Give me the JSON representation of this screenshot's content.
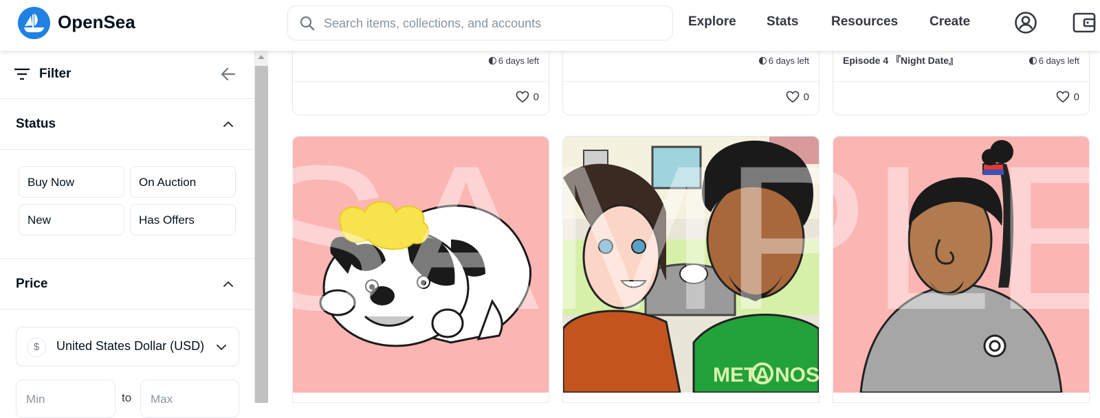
{
  "header": {
    "brand": "OpenSea",
    "search_placeholder": "Search items, collections, and accounts",
    "nav": {
      "explore": "Explore",
      "stats": "Stats",
      "resources": "Resources",
      "create": "Create"
    }
  },
  "sidebar": {
    "filter_label": "Filter",
    "status": {
      "title": "Status",
      "options": [
        "Buy Now",
        "On Auction",
        "New",
        "Has Offers"
      ]
    },
    "price": {
      "title": "Price",
      "currency": "United States Dollar (USD)",
      "currency_symbol": "$",
      "min_placeholder": "Min",
      "to_label": "to",
      "max_placeholder": "Max"
    }
  },
  "cards_top": [
    {
      "title": "",
      "time_left": "6 days left",
      "favorites": "0"
    },
    {
      "title": "",
      "time_left": "6 days left",
      "favorites": "0"
    },
    {
      "title": "Episode 4 『Night Date』",
      "time_left": "6 days left",
      "favorites": "0"
    }
  ],
  "cards_art": [
    {
      "subject": "French bulldog with yellow hair"
    },
    {
      "subject": "Couple with dog on sofa"
    },
    {
      "subject": "Man with topknot in grey sweater"
    }
  ],
  "watermark": "SAMPLE",
  "colors": {
    "brand_blue": "#2081e2",
    "card_pink": "#fbb5b3",
    "text_dark": "#04111d"
  }
}
